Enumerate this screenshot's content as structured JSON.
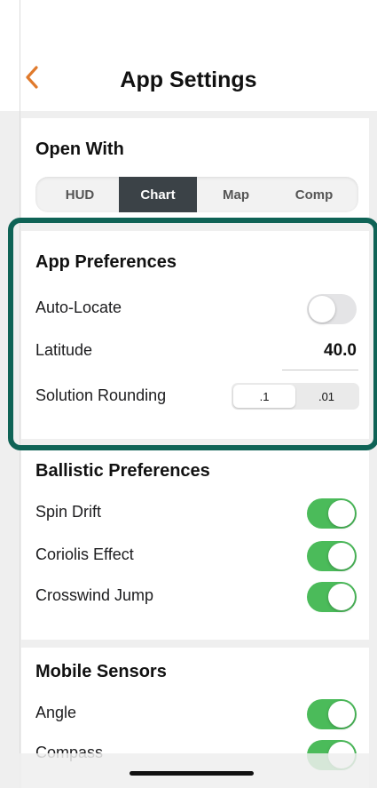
{
  "header": {
    "title": "App Settings",
    "back_icon": "chevron-left-icon",
    "back_color": "#e07a2c"
  },
  "open_with": {
    "title": "Open With",
    "options": [
      "HUD",
      "Chart",
      "Map",
      "Comp"
    ],
    "selected": "Chart"
  },
  "app_preferences": {
    "title": "App Preferences",
    "auto_locate_label": "Auto-Locate",
    "auto_locate_on": false,
    "latitude_label": "Latitude",
    "latitude_value": "40.0",
    "rounding_label": "Solution Rounding",
    "rounding_options": [
      ".1",
      ".01"
    ],
    "rounding_selected": ".1"
  },
  "ballistic_preferences": {
    "title": "Ballistic Preferences",
    "items": [
      {
        "label": "Spin Drift",
        "on": true
      },
      {
        "label": "Coriolis Effect",
        "on": true
      },
      {
        "label": "Crosswind Jump",
        "on": true
      }
    ]
  },
  "mobile_sensors": {
    "title": "Mobile Sensors",
    "items": [
      {
        "label": "Angle",
        "on": true
      },
      {
        "label": "Compass",
        "on": true
      }
    ]
  },
  "colors": {
    "toggle_on": "#4bbb5a",
    "toggle_off": "#e4e4e6",
    "highlight_border": "#0f6356",
    "segment_active": "#3b4247"
  }
}
